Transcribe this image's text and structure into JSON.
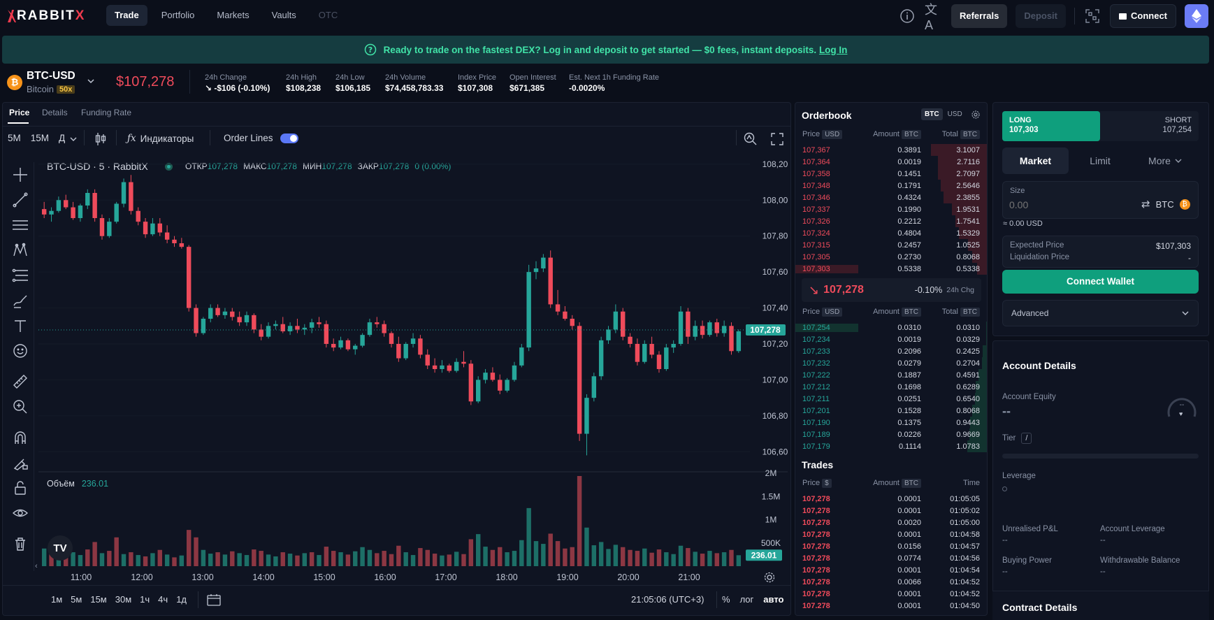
{
  "nav": {
    "logo": "RABBIT",
    "logo_x": "X",
    "tabs": [
      {
        "label": "Trade",
        "active": true
      },
      {
        "label": "Portfolio"
      },
      {
        "label": "Markets"
      },
      {
        "label": "Vaults"
      },
      {
        "label": "OTC",
        "disabled": true
      }
    ],
    "referrals": "Referrals",
    "deposit": "Deposit",
    "connect": "Connect",
    "icons": [
      "info-icon",
      "translate-icon",
      "qr-scan-icon",
      "wallet-icon",
      "ethereum-icon"
    ]
  },
  "banner": {
    "text": "Ready to trade on the fastest DEX? Log in and deposit to get started — $0 fees, instant deposits.",
    "link": "Log In"
  },
  "ticker": {
    "symbol": "BTC-USD",
    "name": "Bitcoin",
    "leverage": "50x",
    "price": "$107,278",
    "stats": [
      {
        "label": "24h Change",
        "value": "↘ -$106 (-0.10%)",
        "color": "#ef4b5b"
      },
      {
        "label": "24h High",
        "value": "$108,238"
      },
      {
        "label": "24h Low",
        "value": "$106,185"
      },
      {
        "label": "24h Volume",
        "value": "$74,458,783.33"
      },
      {
        "label": "Index Price",
        "value": "$107,308"
      },
      {
        "label": "Open Interest",
        "value": "$671,385"
      },
      {
        "label": "Est. Next 1h Funding Rate",
        "value": "-0.0020%"
      }
    ]
  },
  "chart_tabs": [
    "Price",
    "Details",
    "Funding Rate"
  ],
  "toolbar": {
    "intervals": [
      "5M",
      "15M",
      "Д"
    ],
    "indicators": "Индикаторы",
    "order_lines": "Order Lines"
  },
  "chart": {
    "title": "BTC-USD · 5 · RabbitX",
    "ohlc": [
      {
        "k": "ОТКР",
        "v": "107,278"
      },
      {
        "k": "МАКС",
        "v": "107,278"
      },
      {
        "k": "МИН",
        "v": "107,278"
      },
      {
        "k": "ЗАКР",
        "v": "107,278"
      },
      {
        "k": "",
        "v": "0 (0.00%)"
      }
    ],
    "volume_label": "Объём",
    "volume_value": "236.01",
    "current_price_tag": "107,278",
    "current_volume_tag": "236.01",
    "time": "21:05:06 (UTC+3)",
    "bottom_intervals": [
      "1м",
      "5м",
      "15м",
      "30м",
      "1ч",
      "4ч",
      "1д"
    ],
    "bottom_right": [
      "%",
      "лог",
      "авто"
    ],
    "up_color": "#26a69a",
    "down_color": "#ef4b5b"
  },
  "chart_data": {
    "type": "candlestick",
    "x_ticks": [
      "11:00",
      "12:00",
      "13:00",
      "14:00",
      "15:00",
      "16:00",
      "17:00",
      "18:00",
      "19:00",
      "20:00",
      "21:00"
    ],
    "y_ticks": [
      "108,200",
      "108,000",
      "107,800",
      "107,600",
      "107,400",
      "107,200",
      "107,000",
      "106,800",
      "106,600"
    ],
    "ylim": [
      106500,
      108250
    ],
    "vol_ticks": [
      "2M",
      "1.5M",
      "1M",
      "500K"
    ],
    "vol_lim": [
      0,
      2000000
    ],
    "candles": [
      [
        107950,
        107990,
        107900,
        107920
      ],
      [
        107920,
        107960,
        107880,
        107940
      ],
      [
        107940,
        108020,
        107930,
        108000
      ],
      [
        108000,
        108030,
        107950,
        107960
      ],
      [
        107960,
        107990,
        107890,
        107900
      ],
      [
        107900,
        107980,
        107880,
        107970
      ],
      [
        107970,
        108060,
        107950,
        108040
      ],
      [
        108040,
        108060,
        107880,
        107900
      ],
      [
        107900,
        107920,
        107780,
        107800
      ],
      [
        107800,
        107900,
        107790,
        107880
      ],
      [
        107880,
        107990,
        107870,
        107980
      ],
      [
        107980,
        108120,
        107960,
        108100
      ],
      [
        108100,
        108140,
        107920,
        107940
      ],
      [
        107940,
        107960,
        107860,
        107880
      ],
      [
        107880,
        107900,
        107790,
        107810
      ],
      [
        107810,
        107900,
        107800,
        107870
      ],
      [
        107870,
        107900,
        107800,
        107820
      ],
      [
        107820,
        107860,
        107760,
        107780
      ],
      [
        107780,
        107800,
        107740,
        107760
      ],
      [
        107760,
        107790,
        107730,
        107740
      ],
      [
        107740,
        107750,
        107380,
        107400
      ],
      [
        107400,
        107420,
        107240,
        107260
      ],
      [
        107260,
        107350,
        107250,
        107340
      ],
      [
        107340,
        107420,
        107320,
        107400
      ],
      [
        107400,
        107420,
        107350,
        107360
      ],
      [
        107360,
        107400,
        107340,
        107380
      ],
      [
        107380,
        107400,
        107330,
        107350
      ],
      [
        107350,
        107380,
        107300,
        107320
      ],
      [
        107320,
        107380,
        107300,
        107360
      ],
      [
        107360,
        107370,
        107260,
        107280
      ],
      [
        107280,
        107310,
        107220,
        107240
      ],
      [
        107240,
        107320,
        107230,
        107300
      ],
      [
        107300,
        107330,
        107280,
        107310
      ],
      [
        107310,
        107350,
        107260,
        107270
      ],
      [
        107270,
        107320,
        107250,
        107300
      ],
      [
        107300,
        107340,
        107260,
        107280
      ],
      [
        107280,
        107310,
        107250,
        107290
      ],
      [
        107290,
        107340,
        107260,
        107320
      ],
      [
        107320,
        107350,
        107290,
        107310
      ],
      [
        107310,
        107330,
        107180,
        107200
      ],
      [
        107200,
        107230,
        107160,
        107180
      ],
      [
        107180,
        107240,
        107170,
        107220
      ],
      [
        107220,
        107230,
        107160,
        107170
      ],
      [
        107170,
        107200,
        107140,
        107190
      ],
      [
        107190,
        107260,
        107180,
        107250
      ],
      [
        107250,
        107340,
        107240,
        107320
      ],
      [
        107320,
        107350,
        107290,
        107310
      ],
      [
        107310,
        107330,
        107240,
        107260
      ],
      [
        107260,
        107270,
        107180,
        107200
      ],
      [
        107200,
        107240,
        107100,
        107120
      ],
      [
        107120,
        107210,
        107110,
        107200
      ],
      [
        107200,
        107260,
        107180,
        107230
      ],
      [
        107230,
        107250,
        107120,
        107140
      ],
      [
        107140,
        107170,
        107060,
        107080
      ],
      [
        107080,
        107120,
        107040,
        107060
      ],
      [
        107060,
        107110,
        107040,
        107080
      ],
      [
        107080,
        107090,
        107040,
        107050
      ],
      [
        107050,
        107120,
        107040,
        107100
      ],
      [
        107100,
        107160,
        107070,
        107090
      ],
      [
        107090,
        107110,
        106860,
        106880
      ],
      [
        106880,
        107020,
        106870,
        107000
      ],
      [
        107000,
        107060,
        106980,
        107040
      ],
      [
        107040,
        107070,
        106990,
        107000
      ],
      [
        107000,
        107030,
        106920,
        106940
      ],
      [
        106940,
        107010,
        106930,
        107000
      ],
      [
        107000,
        107100,
        106990,
        107080
      ],
      [
        107080,
        107200,
        107070,
        107180
      ],
      [
        107180,
        107640,
        107160,
        107600
      ],
      [
        107600,
        107660,
        107560,
        107620
      ],
      [
        107620,
        107700,
        107600,
        107680
      ],
      [
        107680,
        107720,
        107400,
        107420
      ],
      [
        107420,
        107500,
        107360,
        107380
      ],
      [
        107380,
        107410,
        107330,
        107340
      ],
      [
        107340,
        107360,
        107280,
        107300
      ],
      [
        107300,
        107320,
        106660,
        106700
      ],
      [
        106700,
        106920,
        106580,
        106900
      ],
      [
        106900,
        107040,
        106880,
        107020
      ],
      [
        107020,
        107240,
        107000,
        107220
      ],
      [
        107220,
        107300,
        107200,
        107280
      ],
      [
        107280,
        107420,
        107260,
        107380
      ],
      [
        107380,
        107400,
        107220,
        107240
      ],
      [
        107240,
        107260,
        107180,
        107200
      ],
      [
        107200,
        107230,
        107080,
        107100
      ],
      [
        107100,
        107220,
        107090,
        107200
      ],
      [
        107200,
        107240,
        107120,
        107140
      ],
      [
        107140,
        107160,
        107040,
        107060
      ],
      [
        107060,
        107200,
        107050,
        107180
      ],
      [
        107180,
        107220,
        107150,
        107200
      ],
      [
        107200,
        107410,
        107190,
        107380
      ],
      [
        107380,
        107400,
        107200,
        107240
      ],
      [
        107240,
        107330,
        107220,
        107300
      ],
      [
        107300,
        107330,
        107230,
        107250
      ],
      [
        107250,
        107330,
        107240,
        107320
      ],
      [
        107320,
        107340,
        107240,
        107260
      ],
      [
        107260,
        107330,
        107240,
        107300
      ],
      [
        107300,
        107320,
        107140,
        107160
      ],
      [
        107160,
        107280,
        107150,
        107270
      ]
    ],
    "volumes": [
      [
        380000,
        1
      ],
      [
        260000,
        0
      ],
      [
        320000,
        1
      ],
      [
        410000,
        0
      ],
      [
        300000,
        1
      ],
      [
        240000,
        1
      ],
      [
        360000,
        0
      ],
      [
        520000,
        0
      ],
      [
        280000,
        1
      ],
      [
        330000,
        0
      ],
      [
        620000,
        0
      ],
      [
        260000,
        1
      ],
      [
        300000,
        0
      ],
      [
        240000,
        1
      ],
      [
        210000,
        0
      ],
      [
        280000,
        1
      ],
      [
        350000,
        0
      ],
      [
        250000,
        1
      ],
      [
        190000,
        0
      ],
      [
        230000,
        1
      ],
      [
        780000,
        0
      ],
      [
        620000,
        0
      ],
      [
        350000,
        1
      ],
      [
        270000,
        1
      ],
      [
        300000,
        0
      ],
      [
        250000,
        1
      ],
      [
        320000,
        0
      ],
      [
        280000,
        1
      ],
      [
        240000,
        1
      ],
      [
        360000,
        0
      ],
      [
        330000,
        0
      ],
      [
        250000,
        1
      ],
      [
        210000,
        1
      ],
      [
        300000,
        0
      ],
      [
        270000,
        1
      ],
      [
        230000,
        0
      ],
      [
        280000,
        1
      ],
      [
        300000,
        0
      ],
      [
        240000,
        1
      ],
      [
        420000,
        0
      ],
      [
        330000,
        0
      ],
      [
        300000,
        1
      ],
      [
        250000,
        0
      ],
      [
        320000,
        1
      ],
      [
        410000,
        1
      ],
      [
        350000,
        1
      ],
      [
        280000,
        0
      ],
      [
        330000,
        0
      ],
      [
        260000,
        0
      ],
      [
        440000,
        0
      ],
      [
        300000,
        1
      ],
      [
        240000,
        1
      ],
      [
        390000,
        0
      ],
      [
        350000,
        0
      ],
      [
        270000,
        0
      ],
      [
        230000,
        1
      ],
      [
        250000,
        0
      ],
      [
        310000,
        1
      ],
      [
        260000,
        0
      ],
      [
        580000,
        0
      ],
      [
        690000,
        1
      ],
      [
        420000,
        1
      ],
      [
        350000,
        0
      ],
      [
        410000,
        0
      ],
      [
        300000,
        1
      ],
      [
        330000,
        1
      ],
      [
        560000,
        1
      ],
      [
        1250000,
        1
      ],
      [
        540000,
        1
      ],
      [
        480000,
        1
      ],
      [
        700000,
        0
      ],
      [
        540000,
        0
      ],
      [
        380000,
        0
      ],
      [
        410000,
        0
      ],
      [
        1940000,
        0
      ],
      [
        830000,
        1
      ],
      [
        450000,
        1
      ],
      [
        520000,
        1
      ],
      [
        370000,
        1
      ],
      [
        460000,
        1
      ],
      [
        410000,
        0
      ],
      [
        350000,
        0
      ],
      [
        330000,
        0
      ],
      [
        380000,
        1
      ],
      [
        290000,
        0
      ],
      [
        360000,
        0
      ],
      [
        300000,
        1
      ],
      [
        260000,
        1
      ],
      [
        440000,
        1
      ],
      [
        390000,
        0
      ],
      [
        310000,
        1
      ],
      [
        270000,
        0
      ],
      [
        330000,
        1
      ],
      [
        280000,
        0
      ],
      [
        300000,
        1
      ],
      [
        350000,
        0
      ],
      [
        236010,
        1
      ]
    ]
  },
  "orderbook": {
    "title": "Orderbook",
    "units": [
      "BTC",
      "USD"
    ],
    "headers": {
      "price": "Price",
      "price_unit": "USD",
      "amount": "Amount",
      "amount_unit": "BTC",
      "total": "Total",
      "total_unit": "BTC"
    },
    "asks": [
      [
        "107,367",
        "0.3891",
        "3.1007"
      ],
      [
        "107,364",
        "0.0019",
        "2.7116"
      ],
      [
        "107,358",
        "0.1451",
        "2.7097"
      ],
      [
        "107,348",
        "0.1791",
        "2.5646"
      ],
      [
        "107,346",
        "0.4324",
        "2.3855"
      ],
      [
        "107,337",
        "0.1990",
        "1.9531"
      ],
      [
        "107,326",
        "0.2212",
        "1.7541"
      ],
      [
        "107,324",
        "0.4804",
        "1.5329"
      ],
      [
        "107,315",
        "0.2457",
        "1.0525"
      ],
      [
        "107,305",
        "0.2730",
        "0.8068"
      ],
      [
        "107,303",
        "0.5338",
        "0.5338"
      ]
    ],
    "mid_price": "107,278",
    "mid_change": "-0.10%",
    "mid_change_label": "24h Chg",
    "bids": [
      [
        "107,254",
        "0.0310",
        "0.0310"
      ],
      [
        "107,234",
        "0.0019",
        "0.0329"
      ],
      [
        "107,233",
        "0.2096",
        "0.2425"
      ],
      [
        "107,232",
        "0.0279",
        "0.2704"
      ],
      [
        "107,222",
        "0.1887",
        "0.4591"
      ],
      [
        "107,212",
        "0.1698",
        "0.6289"
      ],
      [
        "107,211",
        "0.0251",
        "0.6540"
      ],
      [
        "107,201",
        "0.1528",
        "0.8068"
      ],
      [
        "107,190",
        "0.1375",
        "0.9443"
      ],
      [
        "107,189",
        "0.0226",
        "0.9669"
      ],
      [
        "107,179",
        "0.1114",
        "1.0783"
      ]
    ]
  },
  "trades": {
    "title": "Trades",
    "headers": {
      "price": "Price",
      "price_unit": "$",
      "amount": "Amount",
      "amount_unit": "BTC",
      "time": "Time"
    },
    "rows": [
      [
        "107,278",
        "0.0001",
        "01:05:05"
      ],
      [
        "107,278",
        "0.0001",
        "01:05:02"
      ],
      [
        "107,278",
        "0.0020",
        "01:05:00"
      ],
      [
        "107,278",
        "0.0001",
        "01:04:58"
      ],
      [
        "107,278",
        "0.0156",
        "01:04:57"
      ],
      [
        "107,278",
        "0.0774",
        "01:04:56"
      ],
      [
        "107,278",
        "0.0001",
        "01:04:54"
      ],
      [
        "107,278",
        "0.0066",
        "01:04:52"
      ],
      [
        "107,278",
        "0.0001",
        "01:04:52"
      ],
      [
        "107,278",
        "0.0001",
        "01:04:50"
      ]
    ]
  },
  "order": {
    "long_label": "LONG",
    "long_price": "107,303",
    "short_label": "SHORT",
    "short_price": "107,254",
    "types": [
      "Market",
      "Limit",
      "More"
    ],
    "size_label": "Size",
    "size_placeholder": "0.00",
    "size_unit": "BTC",
    "approx": "≈ 0.00 USD",
    "expected_label": "Expected Price",
    "expected_value": "$107,303",
    "liq_label": "Liquidation Price",
    "liq_value": "-",
    "connect_wallet": "Connect Wallet",
    "advanced": "Advanced"
  },
  "account": {
    "title": "Account Details",
    "equity_label": "Account Equity",
    "equity_value": "--",
    "gauge_value": "--",
    "tier_label": "Tier",
    "tier_value": "/",
    "leverage_label": "Leverage",
    "fields": [
      {
        "label": "Unrealised P&L",
        "value": "--"
      },
      {
        "label": "Account Leverage",
        "value": "--"
      },
      {
        "label": "Buying Power",
        "value": "--"
      },
      {
        "label": "Withdrawable Balance",
        "value": "--"
      }
    ],
    "contract_title": "Contract Details"
  },
  "colors": {
    "accent_green": "#0f9f7d",
    "down": "#ef4b5b",
    "up": "#26a69a",
    "banner": "#153c40"
  }
}
